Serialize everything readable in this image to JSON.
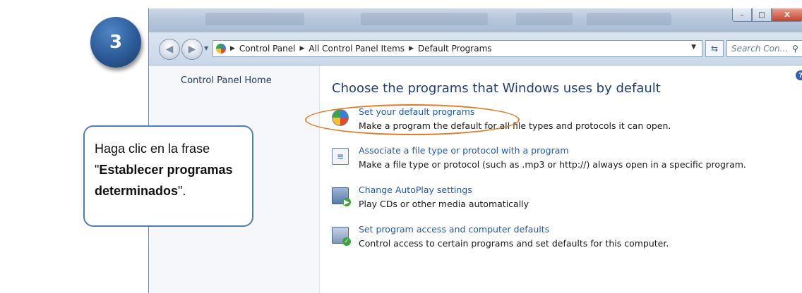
{
  "badge": {
    "number": "3"
  },
  "window": {
    "controls": {
      "minimize": "–",
      "maximize": "□",
      "close": "X"
    }
  },
  "address_bar": {
    "back_icon": "back-arrow-icon",
    "forward_icon": "forward-arrow-icon",
    "breadcrumbs": [
      "Control Panel",
      "All Control Panel Items",
      "Default Programs"
    ],
    "search_placeholder": "Search Con..."
  },
  "sidebar": {
    "home_link": "Control Panel Home"
  },
  "content": {
    "heading": "Choose the programs that Windows uses by default",
    "items": [
      {
        "link": "Set your default programs",
        "description": "Make a program the default for all file types and protocols it can open.",
        "icon": "default-programs-icon"
      },
      {
        "link": "Associate a file type or protocol with a program",
        "description": "Make a file type or protocol (such as .mp3 or http://) always open in a specific program.",
        "icon": "file-association-icon"
      },
      {
        "link": "Change AutoPlay settings",
        "description": "Play CDs or other media automatically",
        "icon": "autoplay-icon"
      },
      {
        "link": "Set program access and computer defaults",
        "description": "Control access to certain programs and set defaults for this computer.",
        "icon": "program-access-icon"
      }
    ]
  },
  "callout": {
    "text_before": "Haga clic en la frase \"",
    "text_bold": "Establecer programas determinados",
    "text_after": "\"."
  },
  "colors": {
    "link": "#1d5bb5",
    "heading": "#1e3f78",
    "highlight": "#e07b2a",
    "callout_border": "#4f7fb8",
    "badge": "#2c5a96"
  }
}
